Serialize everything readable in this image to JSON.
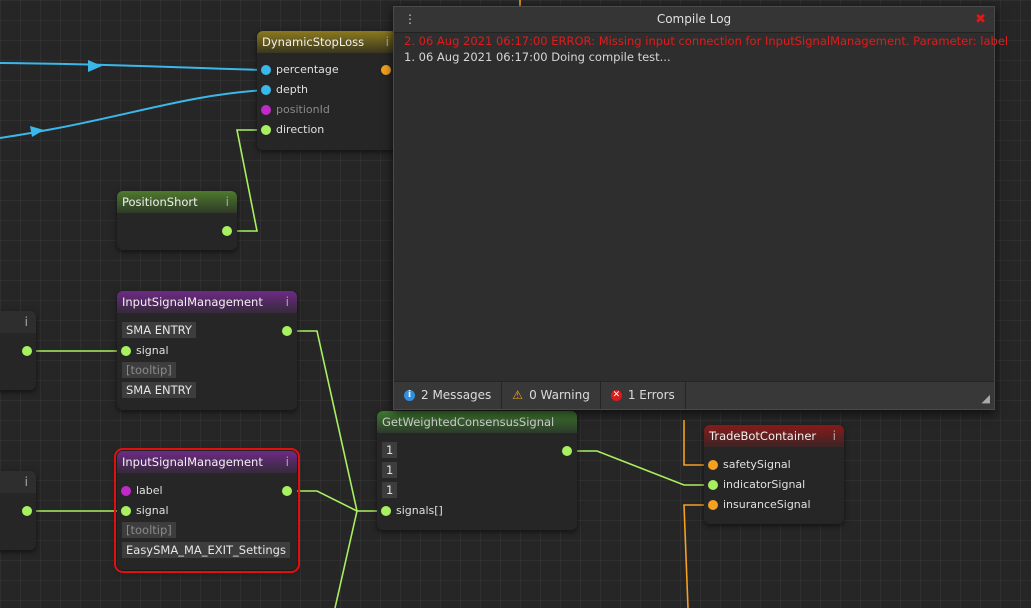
{
  "nodes": {
    "dynamic_stop_loss": {
      "title": "DynamicStopLoss",
      "inputs": [
        "percentage",
        "depth",
        "positionId",
        "direction"
      ]
    },
    "position_short": {
      "title": "PositionShort"
    },
    "input_signal_1": {
      "title": "InputSignalManagement",
      "label_value": "SMA ENTRY",
      "signal": "signal",
      "tooltip": "[tooltip]",
      "desc_value": "SMA ENTRY"
    },
    "input_signal_2": {
      "title": "InputSignalManagement",
      "label": "label",
      "signal": "signal",
      "tooltip": "[tooltip]",
      "desc_value": "EasySMA_MA_EXIT_Settings"
    },
    "weighted_consensus": {
      "title": "GetWeightedConsensusSignal",
      "weights": [
        "1",
        "1",
        "1"
      ],
      "signals": "signals[]"
    },
    "trade_bot_container": {
      "title": "TradeBotContainer",
      "inputs": [
        "safetySignal",
        "indicatorSignal",
        "insuranceSignal"
      ]
    },
    "left_stub_1": {
      "title": "i"
    },
    "left_stub_2": {
      "title": "i"
    }
  },
  "info_glyph": "i",
  "compile_log": {
    "title": "Compile Log",
    "menu_glyph": "⋮",
    "close_glyph": "✖",
    "messages": [
      {
        "type": "error",
        "text": "2. 06 Aug 2021 06:17:00 ERROR: Missing input connection for InputSignalManagement. Parameter: label"
      },
      {
        "type": "info",
        "text": "1. 06 Aug 2021 06:17:00 Doing compile test..."
      }
    ],
    "status": {
      "messages": "2 Messages",
      "warnings": "0 Warning",
      "errors": "1 Errors"
    }
  },
  "colors": {
    "pin_blue": "#3ab8ea",
    "pin_green": "#a8f060",
    "pin_purple": "#c02ac8",
    "pin_orange": "#f4a020",
    "error_red": "#e01c1c"
  }
}
